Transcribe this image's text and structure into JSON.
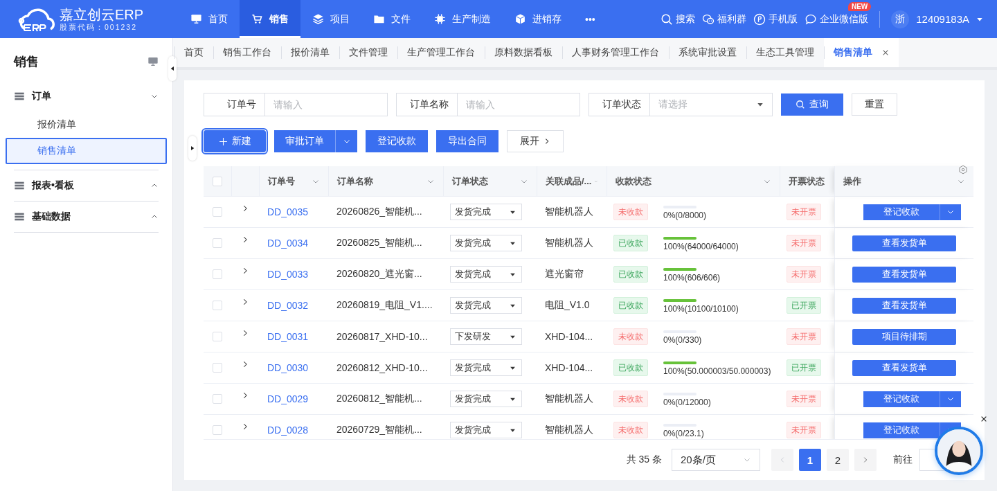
{
  "header": {
    "logo": {
      "name": "嘉立创云ERP",
      "subtitle": "股票代码：001232"
    },
    "nav": [
      {
        "label": "首页",
        "selected": false
      },
      {
        "label": "销售",
        "selected": true
      },
      {
        "label": "项目",
        "selected": false
      },
      {
        "label": "文件",
        "selected": false
      },
      {
        "label": "生产制造",
        "selected": false
      },
      {
        "label": "进销存",
        "selected": false
      },
      {
        "label": "•••",
        "selected": false
      }
    ],
    "tools": [
      {
        "label": "搜索"
      },
      {
        "label": "福利群"
      },
      {
        "label": "手机版"
      },
      {
        "label": "企业微信版",
        "badge": "NEW"
      }
    ],
    "user": {
      "avatar": "浙",
      "name": "12409183A"
    }
  },
  "sidebar": {
    "title": "销售",
    "groups": [
      {
        "label": "订单",
        "expanded": true,
        "children": [
          {
            "label": "报价清单",
            "selected": false
          },
          {
            "label": "销售清单",
            "selected": true
          }
        ]
      },
      {
        "label": "报表•看板",
        "expanded": false
      },
      {
        "label": "基础数据",
        "expanded": false
      }
    ]
  },
  "tabs": [
    {
      "label": "首页",
      "selected": false
    },
    {
      "label": "销售工作台",
      "selected": false
    },
    {
      "label": "报价清单",
      "selected": false
    },
    {
      "label": "文件管理",
      "selected": false
    },
    {
      "label": "生产管理工作台",
      "selected": false
    },
    {
      "label": "原料数据看板",
      "selected": false
    },
    {
      "label": "人事财务管理工作台",
      "selected": false
    },
    {
      "label": "系统审批设置",
      "selected": false
    },
    {
      "label": "生态工具管理",
      "selected": false
    },
    {
      "label": "销售清单",
      "selected": true,
      "closable": true
    }
  ],
  "filters": [
    {
      "label": "订单号",
      "kind": "input",
      "placeholder": "请输入"
    },
    {
      "label": "订单名称",
      "kind": "input",
      "placeholder": "请输入"
    },
    {
      "label": "订单状态",
      "kind": "select",
      "placeholder": "请选择"
    }
  ],
  "filter_buttons": [
    {
      "label": "查询",
      "kind": "primary"
    },
    {
      "label": "重置",
      "kind": "plain"
    }
  ],
  "toolbar": [
    {
      "label": "新建",
      "kind": "create"
    },
    {
      "label": "审批订单",
      "kind": "split"
    },
    {
      "label": "登记收款",
      "kind": "primary"
    },
    {
      "label": "导出合同",
      "kind": "primary"
    },
    {
      "label": "展开",
      "kind": "expand"
    }
  ],
  "table": {
    "all_checked": false,
    "columns": [
      "订单号",
      "订单名称",
      "订单状态",
      "关联成品/...",
      "收款状态",
      "开票状态",
      "操作"
    ],
    "rows": [
      {
        "checked": false,
        "id": "DD_0035",
        "name": "20260826_智能机...",
        "status": "发货完成",
        "product": "智能机器人",
        "payment": {
          "text": "未收款",
          "kind": "unpaid"
        },
        "progress": "0%(0/8000)",
        "level": 0,
        "invoice": {
          "text": "未开票",
          "kind": "unpaid"
        },
        "action": {
          "label": "登记收款",
          "kind": "split"
        }
      },
      {
        "checked": false,
        "id": "DD_0034",
        "name": "20260825_智能机...",
        "status": "发货完成",
        "product": "智能机器人",
        "payment": {
          "text": "已收款",
          "kind": "paid"
        },
        "progress": "100%(64000/64000)",
        "level": 1,
        "invoice": {
          "text": "未开票",
          "kind": "unpaid"
        },
        "action": {
          "label": "查看发货单",
          "kind": "plain"
        }
      },
      {
        "checked": false,
        "id": "DD_0033",
        "name": "20260820_遮光窗...",
        "status": "发货完成",
        "product": "遮光窗帘",
        "payment": {
          "text": "已收款",
          "kind": "paid"
        },
        "progress": "100%(606/606)",
        "level": 1,
        "invoice": {
          "text": "未开票",
          "kind": "unpaid"
        },
        "action": {
          "label": "查看发货单",
          "kind": "plain"
        }
      },
      {
        "checked": false,
        "id": "DD_0032",
        "name": "20260819_电阻_V1....",
        "status": "发货完成",
        "product": "电阻_V1.0",
        "payment": {
          "text": "已收款",
          "kind": "paid"
        },
        "progress": "100%(10100/10100)",
        "level": 1,
        "invoice": {
          "text": "已开票",
          "kind": "paid"
        },
        "action": {
          "label": "查看发货单",
          "kind": "plain"
        }
      },
      {
        "checked": false,
        "id": "DD_0031",
        "name": "20260817_XHD-10...",
        "status": "下发研发",
        "product": "XHD-104...",
        "payment": {
          "text": "未收款",
          "kind": "unpaid"
        },
        "progress": "0%(0/330)",
        "level": 0,
        "invoice": {
          "text": "未开票",
          "kind": "unpaid"
        },
        "action": {
          "label": "项目待排期",
          "kind": "plain"
        }
      },
      {
        "checked": false,
        "id": "DD_0030",
        "name": "20260812_XHD-10...",
        "status": "发货完成",
        "product": "XHD-104...",
        "payment": {
          "text": "已收款",
          "kind": "paid"
        },
        "progress": "100%(50.000003/50.000003)",
        "level": 1,
        "invoice": {
          "text": "已开票",
          "kind": "paid"
        },
        "action": {
          "label": "查看发货单",
          "kind": "plain"
        }
      },
      {
        "checked": false,
        "id": "DD_0029",
        "name": "20260812_智能机...",
        "status": "发货完成",
        "product": "智能机器人",
        "payment": {
          "text": "未收款",
          "kind": "unpaid"
        },
        "progress": "0%(0/12000)",
        "level": 0,
        "invoice": {
          "text": "未开票",
          "kind": "unpaid"
        },
        "action": {
          "label": "登记收款",
          "kind": "split"
        }
      },
      {
        "checked": false,
        "id": "DD_0028",
        "name": "20260729_智能机...",
        "status": "发货完成",
        "product": "智能机器人",
        "payment": {
          "text": "未收款",
          "kind": "unpaid"
        },
        "progress": "0%(0/23.1)",
        "level": 0,
        "invoice": {
          "text": "未开票",
          "kind": "unpaid"
        },
        "action": {
          "label": "登记收款",
          "kind": "split"
        }
      }
    ]
  },
  "pager": {
    "total": "共 35 条",
    "page_size": "20条/页",
    "pages": [
      {
        "label": "1",
        "selected": true
      },
      {
        "label": "2",
        "selected": false
      }
    ],
    "goto": "前往"
  }
}
